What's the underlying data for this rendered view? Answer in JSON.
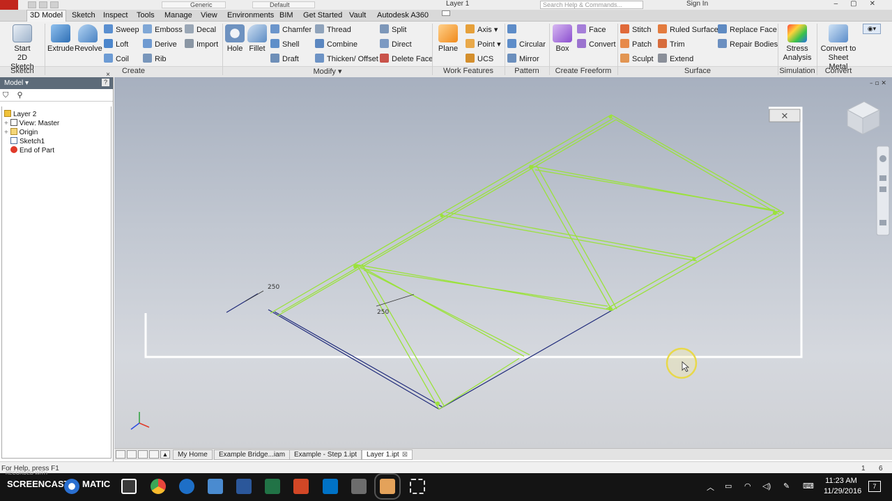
{
  "titlebar": {
    "style": "Generic",
    "appearance": "Default",
    "doc_title": "Layer 1",
    "search_placeholder": "Search Help & Commands...",
    "sign_in": "Sign In"
  },
  "menu_tabs": [
    "3D Model",
    "Sketch",
    "Inspect",
    "Tools",
    "Manage",
    "View",
    "Environments",
    "BIM",
    "Get Started",
    "Vault",
    "Autodesk A360"
  ],
  "ribbon": {
    "sketch": {
      "start_line1": "Start",
      "start_line2": "2D Sketch",
      "panel": "Sketch"
    },
    "create": {
      "extrude": "Extrude",
      "revolve": "Revolve",
      "sweep": "Sweep",
      "emboss": "Emboss",
      "decal": "Decal",
      "loft": "Loft",
      "derive": "Derive",
      "import": "Import",
      "coil": "Coil",
      "rib": "Rib",
      "panel": "Create"
    },
    "modify": {
      "hole": "Hole",
      "fillet": "Fillet",
      "chamfer": "Chamfer",
      "thread": "Thread",
      "split": "Split",
      "shell": "Shell",
      "combine": "Combine",
      "direct": "Direct",
      "draft": "Draft",
      "thicken": "Thicken/ Offset",
      "delete_face": "Delete Face",
      "panel": "Modify"
    },
    "work": {
      "plane": "Plane",
      "axis": "Axis",
      "point": "Point",
      "ucs": "UCS",
      "panel": "Work Features"
    },
    "pattern": {
      "circular": "Circular",
      "mirror": "Mirror",
      "panel": "Pattern"
    },
    "freeform": {
      "box": "Box",
      "face": "Face",
      "convert": "Convert",
      "panel": "Create Freeform"
    },
    "surface": {
      "stitch": "Stitch",
      "ruled": "Ruled Surface",
      "replace": "Replace Face",
      "patch": "Patch",
      "trim": "Trim",
      "repair": "Repair Bodies",
      "sculpt": "Sculpt",
      "extend": "Extend",
      "panel": "Surface"
    },
    "simulation": {
      "line1": "Stress",
      "line2": "Analysis",
      "panel": "Simulation"
    },
    "convert": {
      "line1": "Convert to",
      "line2": "Sheet Metal",
      "panel": "Convert"
    }
  },
  "browser": {
    "title": "Model",
    "help": "?",
    "nodes": [
      "Layer 2",
      "View: Master",
      "Origin",
      "Sketch1",
      "End of Part"
    ]
  },
  "viewport": {
    "dim_1": "250",
    "dim_2": "250",
    "truss_color": "#9be23b",
    "base_color": "#1f2a7a"
  },
  "doc_tabs": [
    "My Home",
    "Example Bridge...iam",
    "Example - Step 1.ipt",
    "Layer 1.ipt"
  ],
  "status": {
    "help": "For Help, press F1",
    "count_a": "1",
    "count_b": "6"
  },
  "taskbar": {
    "recorder_top": "RECORDED WITH",
    "recorder_brand": "SCREENCAST",
    "recorder_suffix": "MATIC",
    "time": "11:23 AM",
    "date": "11/29/2016",
    "notif": "7"
  }
}
